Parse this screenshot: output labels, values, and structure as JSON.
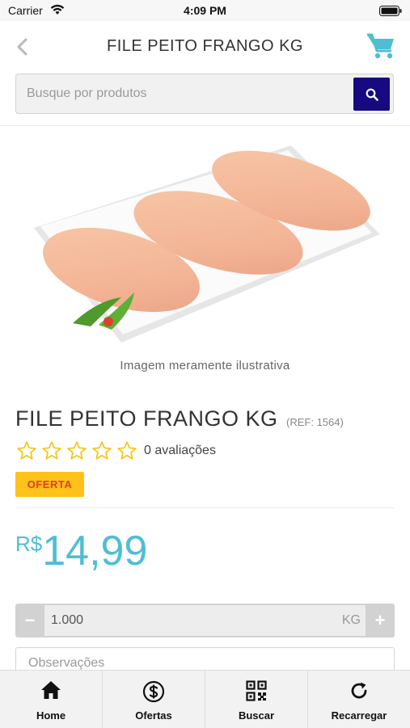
{
  "status_bar": {
    "carrier": "Carrier",
    "time": "4:09 PM"
  },
  "nav": {
    "title": "FILE PEITO FRANGO KG",
    "back_icon": "chevron-left-icon",
    "cart_icon": "shopping-cart-icon",
    "accent": "#4fbed3"
  },
  "search": {
    "placeholder": "Busque por produtos",
    "value": "",
    "button_color": "#170a80"
  },
  "product": {
    "image_caption": "Imagem meramente ilustrativa",
    "name": "FILE PEITO FRANGO KG",
    "ref": "(REF: 1564)",
    "rating": {
      "stars_filled": 0,
      "stars_total": 5,
      "count_label": "0 avaliações"
    },
    "badge": "OFERTA",
    "price": {
      "currency": "R$",
      "value": "14,99"
    }
  },
  "quantity": {
    "minus": "−",
    "plus": "+",
    "value": "1.000",
    "unit": "KG"
  },
  "notes": {
    "placeholder": "Observações"
  },
  "tabs": [
    {
      "label": "Home",
      "icon": "home-icon"
    },
    {
      "label": "Ofertas",
      "icon": "dollar-circle-icon"
    },
    {
      "label": "Buscar",
      "icon": "qr-code-icon"
    },
    {
      "label": "Recarregar",
      "icon": "refresh-icon"
    }
  ]
}
